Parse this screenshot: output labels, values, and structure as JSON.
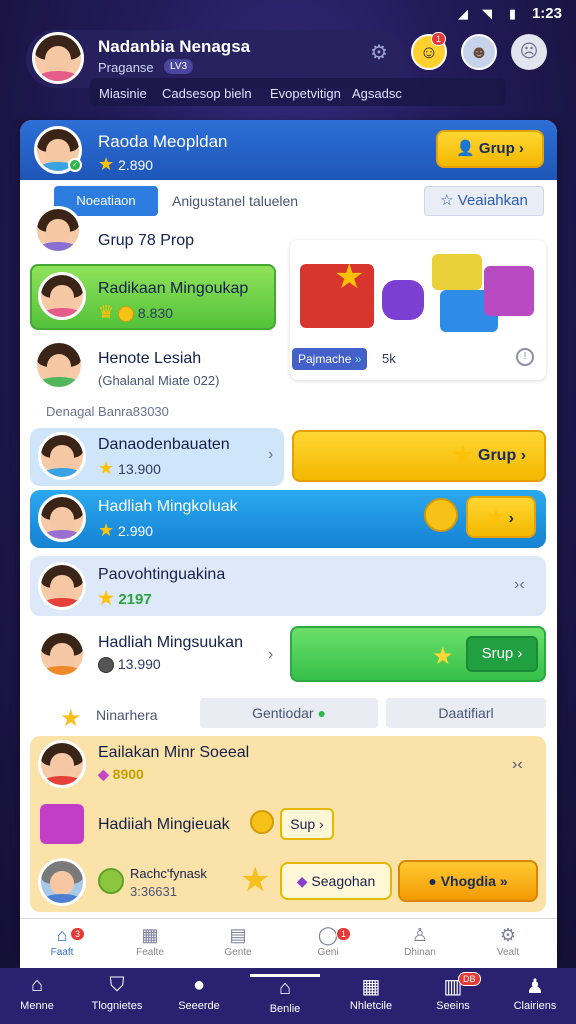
{
  "status_bar": {
    "time": "1:23"
  },
  "header": {
    "user_name": "Nadanbia Nenagsa",
    "user_sub": "Praganse",
    "user_level": "LV3",
    "tabs": [
      "Miasinie",
      "Cadsesop bieln",
      "Evopetvitign",
      "Agsadsc"
    ]
  },
  "banner": {
    "title": "Raoda Meopldan",
    "coins": "2.890",
    "button": "Grup"
  },
  "subheader": {
    "tab_active": "Noeatiaon",
    "tab_text": "Anigustanel taluelen",
    "right_button": "Veaiahkan"
  },
  "items": [
    {
      "title": "Grup 78 Prop"
    },
    {
      "title": "Radikaan Mingoukap",
      "value": "8.830"
    },
    {
      "title": "Henote Lesiah",
      "sub": "(Ghalanal Miate 022)"
    },
    {
      "caption": "Denagal Banra83030"
    },
    {
      "title": "Danaodenbauaten",
      "value": "13.900",
      "button": "Grup"
    },
    {
      "title": "Hadliah Mingkoluak",
      "value": "2.990"
    },
    {
      "title": "Paovohtinguakina",
      "value": "2197"
    },
    {
      "title": "Hadliah Mingsuukan",
      "value": "13.990",
      "button": "Srup"
    }
  ],
  "promo": {
    "pill_label": "Pajmache",
    "pill_value": "5k"
  },
  "filter": {
    "label": "Ninarhera",
    "chip1": "Gentiodar",
    "chip2": "Daatifiarl"
  },
  "panel": {
    "title": "Eailakan Minr Soeeal",
    "value": "8900",
    "gift_title": "Hadiiah Mingieuak",
    "gift_button": "Sup",
    "user_name": "Rachc'fynask",
    "user_value": "3:36631",
    "btn_secondary": "Seagohan",
    "btn_primary": "Vhogdia"
  },
  "bottom_tabs": [
    "Faaft",
    "Fealte",
    "Gente",
    "Geni",
    "Dhinan",
    "Vealt"
  ],
  "system_nav": [
    "Menne",
    "Tlognietes",
    "Seeerde",
    "Benlie",
    "Nhletcile",
    "Seeins",
    "Clairiens"
  ],
  "system_badge": "DB",
  "colors": {
    "blue": "#2d6fd6",
    "yellow": "#ffd633",
    "green": "#4cd15a",
    "bar": "#2a2170"
  }
}
